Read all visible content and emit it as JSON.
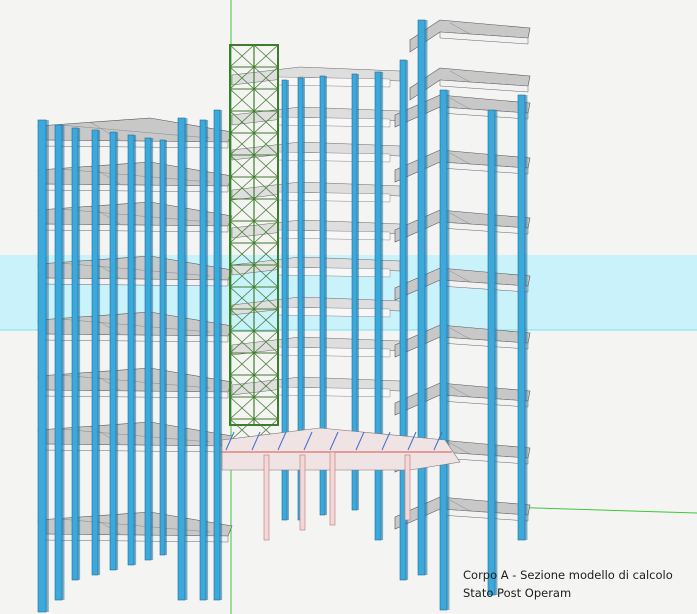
{
  "caption": {
    "line1": "Corpo A - Sezione modello di calcolo",
    "line2": "Stato Post Operam"
  },
  "colors": {
    "background": "#f4f4f2",
    "horizon_band": "#c9f2fa",
    "column_blue": "#3aa9dc",
    "column_blue_dark": "#1f6f9c",
    "slab": "#c8c8c8",
    "slab_underside": "#dedede",
    "slab_edge": "#f2f2f2",
    "bracing_green": "#3f7d2e",
    "axis_green": "#3cc83c",
    "ground_plate": "#efe3e3",
    "ground_beam_blue": "#3b6fd0",
    "ground_beam_pink": "#e07070"
  },
  "scene": {
    "subject": "3D structural analysis model of multi-storey reinforced concrete building",
    "floors_visible": 9,
    "elements": [
      "columns",
      "floor-slabs",
      "beams",
      "braced-steel-tower",
      "ground-floor-beams"
    ]
  }
}
